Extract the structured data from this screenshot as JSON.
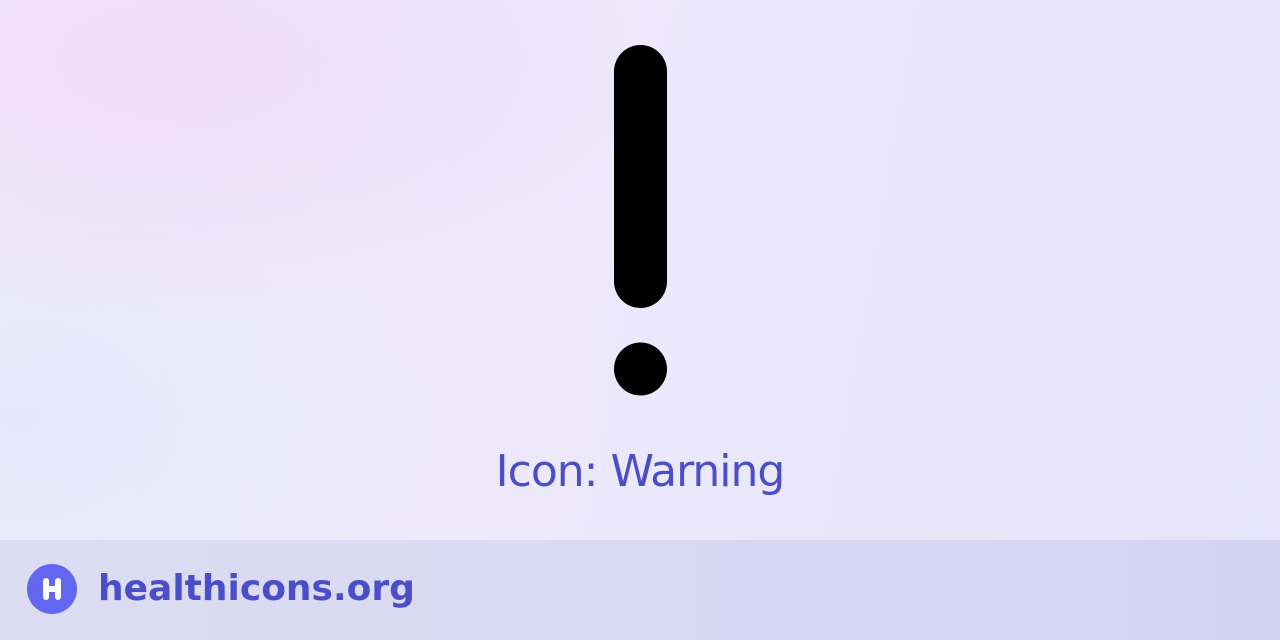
{
  "hero": {
    "icon": "warning-icon",
    "title": "Icon: Warning"
  },
  "footer": {
    "logo_icon": "healthicons-logo-icon",
    "site": "healthicons.org"
  },
  "colors": {
    "accent": "#4a4fc9",
    "logo_bg": "#6366f1",
    "icon": "#000000",
    "footer_bg": "#d9d8f3"
  }
}
